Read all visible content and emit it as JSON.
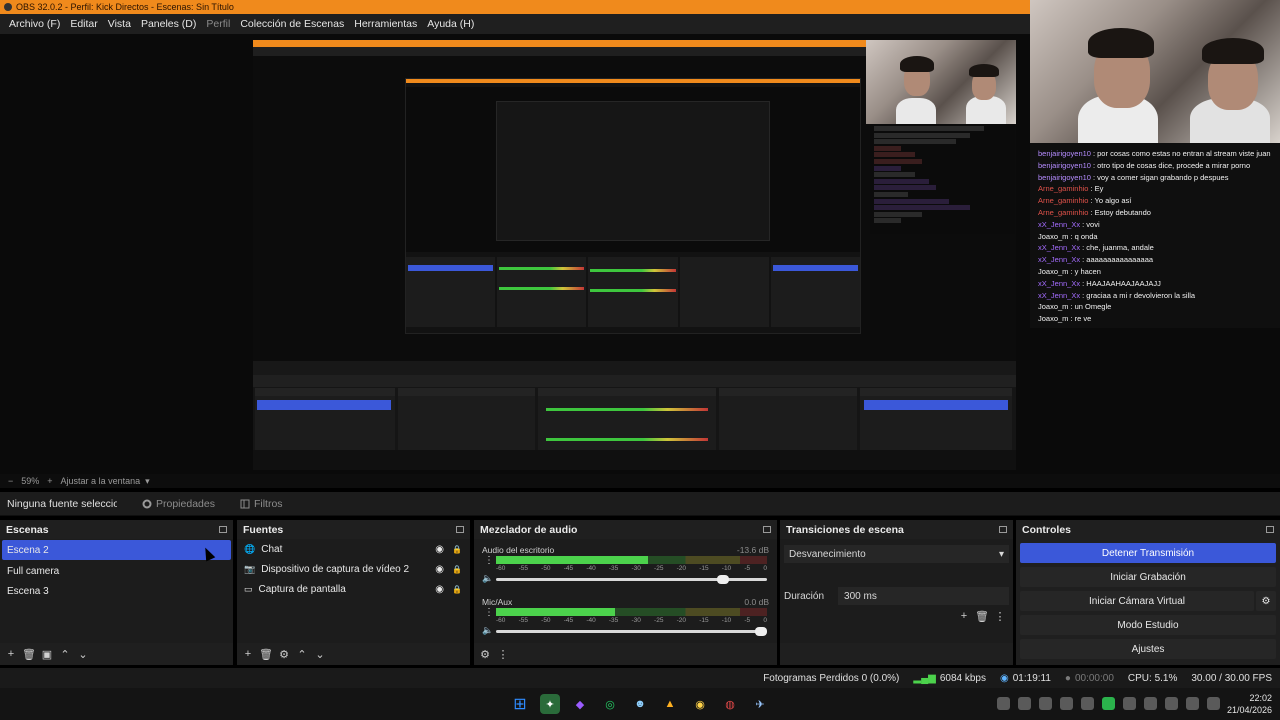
{
  "window": {
    "title": "OBS 32.0.2 - Perfil: Kick Directos - Escenas: Sin Título"
  },
  "menu": [
    "Archivo (F)",
    "Editar",
    "Vista",
    "Paneles (D)",
    "Perfil",
    "Colección de Escenas",
    "Herramientas",
    "Ayuda (H)"
  ],
  "zoom": {
    "percent": "59%",
    "add": "+",
    "fit": "Ajustar a la ventana"
  },
  "source_toolbar": {
    "no_source": "Ninguna fuente seleccionada",
    "properties": "Propiedades",
    "filters": "Filtros"
  },
  "scenes": {
    "title": "Escenas",
    "items": [
      {
        "label": "Escena 2",
        "selected": true
      },
      {
        "label": "Full camera",
        "selected": false
      },
      {
        "label": "Escena 3",
        "selected": false
      }
    ]
  },
  "sources": {
    "title": "Fuentes",
    "items": [
      {
        "label": "Chat",
        "icon": "globe-icon"
      },
      {
        "label": "Dispositivo de captura de vídeo 2",
        "icon": "camera-icon"
      },
      {
        "label": "Captura de pantalla",
        "icon": "monitor-icon"
      }
    ]
  },
  "mixer": {
    "title": "Mezclador de audio",
    "channels": [
      {
        "name": "Audio del escritorio",
        "db": "-13.6 dB",
        "level": 0.56,
        "volume": 0.86
      },
      {
        "name": "Mic/Aux",
        "db": "0.0 dB",
        "level": 0.44,
        "volume": 1.0
      }
    ],
    "ticks": [
      "-60",
      "-55",
      "-50",
      "-45",
      "-40",
      "-35",
      "-30",
      "-25",
      "-20",
      "-15",
      "-10",
      "-5",
      "0"
    ]
  },
  "transitions": {
    "title": "Transiciones de escena",
    "selected": "Desvanecimiento",
    "duration_label": "Duración",
    "duration_value": "300 ms"
  },
  "controls": {
    "title": "Controles",
    "buttons": [
      "Detener Transmisión",
      "Iniciar Grabación",
      "Iniciar Cámara Virtual",
      "Modo Estudio",
      "Ajustes"
    ]
  },
  "status": {
    "dropped": "Fotogramas Perdidos 0 (0.0%)",
    "bitrate": "6084 kbps",
    "stream_time": "01:19:11",
    "rec_time": "00:00:00",
    "cpu": "CPU: 5.1%",
    "fps": "30.00 / 30.00 FPS"
  },
  "chat": {
    "lines": [
      {
        "user": "benjairigoyen10",
        "msg": "por cosas como estas no entran al stream viste juan",
        "color": "#b58cff"
      },
      {
        "user": "benjairigoyen10",
        "msg": "otro tipo de cosas dice, procede a mirar porno",
        "color": "#b58cff"
      },
      {
        "user": "benjairigoyen10",
        "msg": "voy a comer sigan grabando p despues",
        "color": "#b58cff"
      },
      {
        "user": "Arne_gaminhio",
        "msg": "Ey",
        "color": "#e0524a"
      },
      {
        "user": "Arne_gaminhio",
        "msg": "Yo algo así",
        "color": "#e0524a"
      },
      {
        "user": "Arne_gaminhio",
        "msg": "Estoy debutando",
        "color": "#e0524a"
      },
      {
        "user": "xX_Jenn_Xx",
        "msg": "vovi",
        "color": "#a46cff"
      },
      {
        "user": "Joaxo_m",
        "msg": "q onda",
        "color": "#f2f2f2"
      },
      {
        "user": "xX_Jenn_Xx",
        "msg": "che, juanma, andale",
        "color": "#a46cff"
      },
      {
        "user": "xX_Jenn_Xx",
        "msg": "aaaaaaaaaaaaaaaa",
        "color": "#a46cff"
      },
      {
        "user": "Joaxo_m",
        "msg": "y hacen",
        "color": "#f2f2f2"
      },
      {
        "user": "xX_Jenn_Xx",
        "msg": "HAAJAAHAAJAAJAJJ",
        "color": "#a46cff"
      },
      {
        "user": "xX_Jenn_Xx",
        "msg": "graciaa a mi r devolvieron la silla",
        "color": "#a46cff"
      },
      {
        "user": "Joaxo_m",
        "msg": "un Omegle",
        "color": "#f2f2f2"
      },
      {
        "user": "Joaxo_m",
        "msg": "re ve",
        "color": "#f2f2f2"
      }
    ]
  },
  "clock": {
    "time": "22:02",
    "date": "21/04/2026"
  },
  "colors": {
    "accent": "#3b58d9",
    "titlebar": "#f08a1c"
  }
}
